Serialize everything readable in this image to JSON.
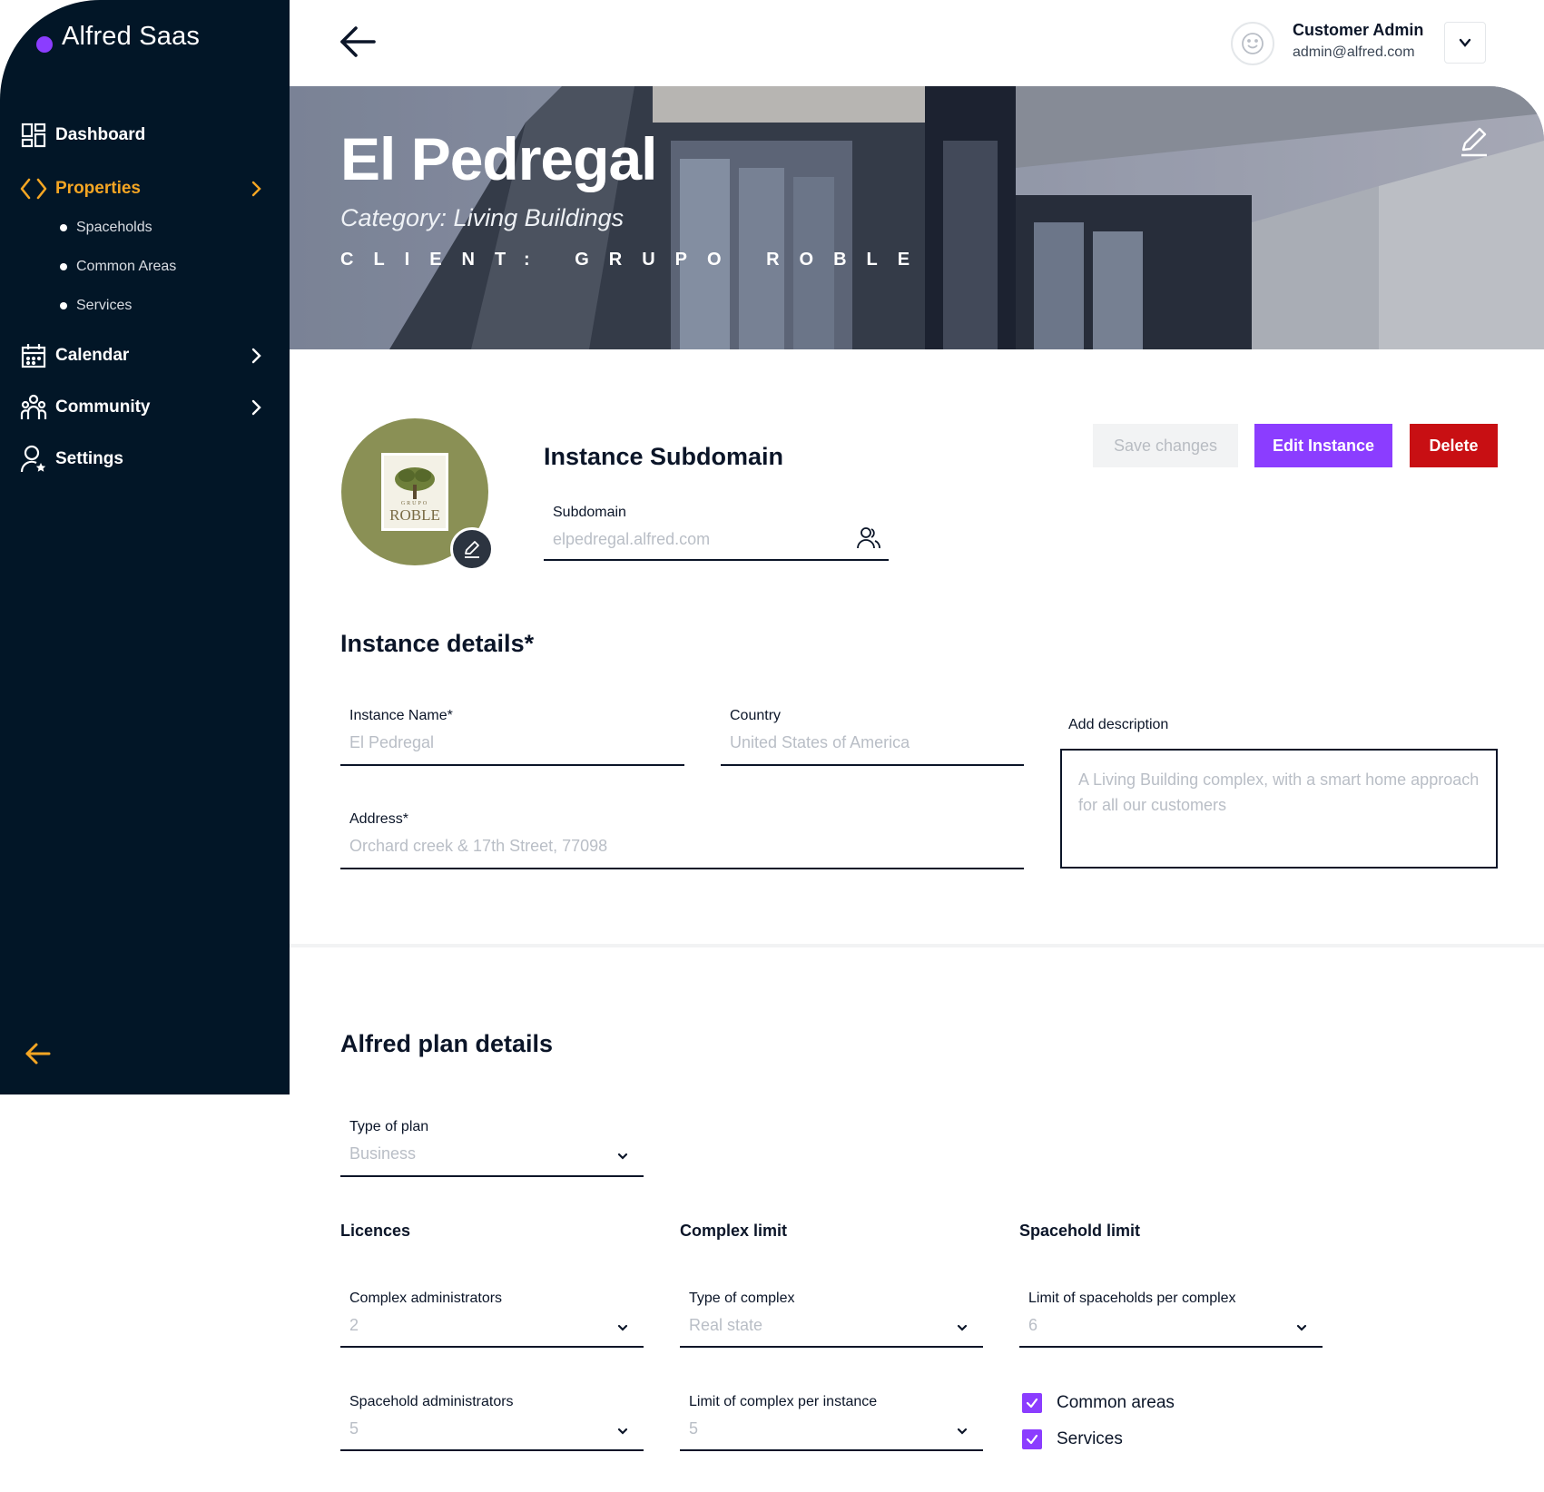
{
  "app": {
    "brand": "Alfred Saas"
  },
  "sidebar": {
    "items": [
      {
        "label": "Dashboard",
        "icon": "dashboard-icon"
      },
      {
        "label": "Properties",
        "icon": "code-brackets-icon",
        "active": true,
        "children": [
          {
            "label": "Spaceholds"
          },
          {
            "label": "Common Areas"
          },
          {
            "label": "Services"
          }
        ]
      },
      {
        "label": "Calendar",
        "icon": "calendar-icon"
      },
      {
        "label": "Community",
        "icon": "community-icon"
      },
      {
        "label": "Settings",
        "icon": "user-settings-icon"
      }
    ],
    "accent_color": "#f5a623"
  },
  "header": {
    "user_name": "Customer Admin",
    "user_email": "admin@alfred.com"
  },
  "hero": {
    "title": "El Pedregal",
    "category": "Category: Living Buildings",
    "client": "CLIENT: GRUPO ROBLE"
  },
  "logo": {
    "small_text": "GRUPO",
    "big_text": "ROBLE"
  },
  "subdomain": {
    "heading": "Instance Subdomain",
    "label": "Subdomain",
    "value": "elpedregal.alfred.com"
  },
  "actions": {
    "save": "Save changes",
    "edit": "Edit Instance",
    "delete": "Delete"
  },
  "instance_details": {
    "heading": "Instance details*",
    "name_label": "Instance Name*",
    "name_value": "El Pedregal",
    "country_label": "Country",
    "country_value": "United States of America",
    "address_label": "Address*",
    "address_value": "Orchard creek & 17th Street, 77098",
    "description_label": "Add description",
    "description_value": "A Living Building complex, with a smart home approach for all our customers"
  },
  "plan": {
    "heading": "Alfred plan details",
    "type_label": "Type of plan",
    "type_value": "Business",
    "licences": {
      "heading": "Licences",
      "complex_admins_label": "Complex administrators",
      "complex_admins_value": "2",
      "spacehold_admins_label": "Spacehold administrators",
      "spacehold_admins_value": "5"
    },
    "complex_limit": {
      "heading": "Complex limit",
      "type_label": "Type of complex",
      "type_value": "Real state",
      "limit_label": "Limit of complex per instance",
      "limit_value": "5"
    },
    "spacehold_limit": {
      "heading": "Spacehold limit",
      "limit_label": "Limit of spaceholds per complex",
      "limit_value": "6",
      "common_areas_label": "Common areas",
      "common_areas_checked": true,
      "services_label": "Services",
      "services_checked": true
    }
  },
  "colors": {
    "sidebar_bg": "#021627",
    "primary": "#8b3dff",
    "danger": "#c80f13"
  }
}
